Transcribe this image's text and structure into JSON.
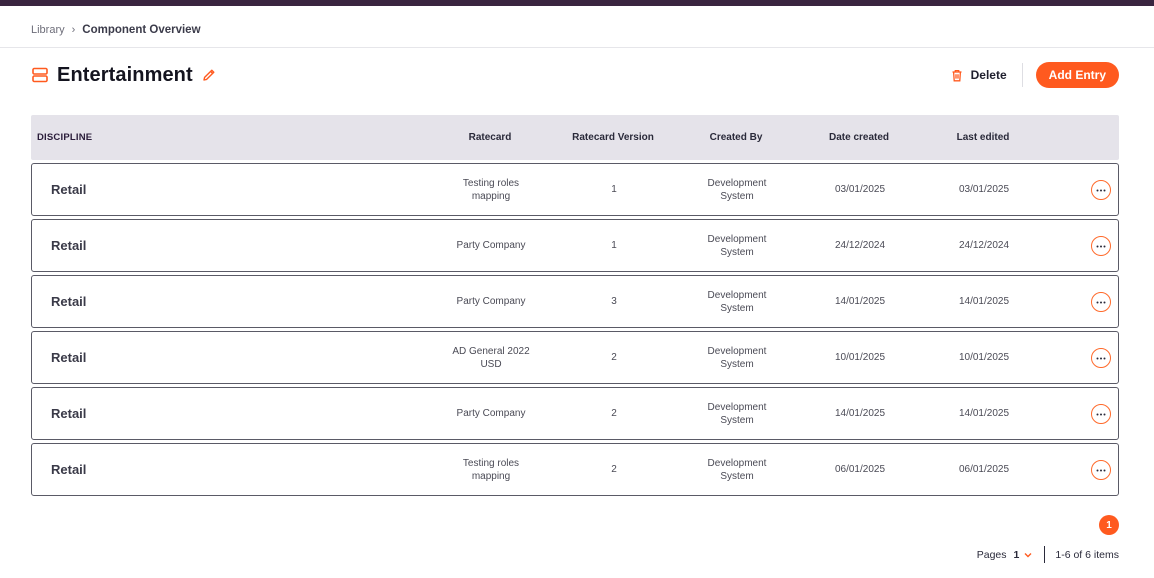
{
  "breadcrumb": {
    "parent": "Library",
    "separator": "›",
    "current": "Component Overview"
  },
  "header": {
    "title": "Entertainment",
    "delete_label": "Delete",
    "add_label": "Add Entry"
  },
  "colors": {
    "accent": "#ff5a1f",
    "topbar": "#3a2540",
    "header_bg": "#e5e3ea"
  },
  "table": {
    "columns": [
      "DISCIPLINE",
      "Ratecard",
      "Ratecard Version",
      "Created By",
      "Date created",
      "Last edited"
    ],
    "rows": [
      {
        "discipline": "Retail",
        "ratecard": [
          "Testing roles",
          "mapping"
        ],
        "version": "1",
        "created_by": [
          "Development",
          "System"
        ],
        "date_created": "03/01/2025",
        "last_edited": "03/01/2025"
      },
      {
        "discipline": "Retail",
        "ratecard": [
          "Party Company"
        ],
        "version": "1",
        "created_by": [
          "Development",
          "System"
        ],
        "date_created": "24/12/2024",
        "last_edited": "24/12/2024"
      },
      {
        "discipline": "Retail",
        "ratecard": [
          "Party Company"
        ],
        "version": "3",
        "created_by": [
          "Development",
          "System"
        ],
        "date_created": "14/01/2025",
        "last_edited": "14/01/2025"
      },
      {
        "discipline": "Retail",
        "ratecard": [
          "AD General 2022",
          "USD"
        ],
        "version": "2",
        "created_by": [
          "Development",
          "System"
        ],
        "date_created": "10/01/2025",
        "last_edited": "10/01/2025"
      },
      {
        "discipline": "Retail",
        "ratecard": [
          "Party Company"
        ],
        "version": "2",
        "created_by": [
          "Development",
          "System"
        ],
        "date_created": "14/01/2025",
        "last_edited": "14/01/2025"
      },
      {
        "discipline": "Retail",
        "ratecard": [
          "Testing roles",
          "mapping"
        ],
        "version": "2",
        "created_by": [
          "Development",
          "System"
        ],
        "date_created": "06/01/2025",
        "last_edited": "06/01/2025"
      }
    ]
  },
  "pagination": {
    "current_page_badge": "1",
    "pages_label": "Pages",
    "selected_page": "1",
    "items_summary": "1-6 of 6 items"
  },
  "icons": {
    "title": "stack-icon",
    "edit": "pencil-icon",
    "delete": "trash-icon",
    "row_menu": "more-horizontal-icon",
    "page_select": "chevron-down-icon"
  }
}
